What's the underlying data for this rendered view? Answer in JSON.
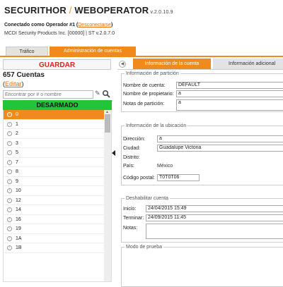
{
  "header": {
    "brand_left": "SECURITHOR",
    "brand_sep": " / ",
    "brand_right": "WEBOPERATOR",
    "version": " v.2.0.10.9",
    "connected_prefix": "Conectado como Operador #1 (",
    "disconnect_link": "Desconectarse",
    "connected_suffix": ")",
    "company": "MCDI Security Products Inc. [00000] | ST v.2.0.7.0"
  },
  "main_tabs": [
    {
      "label": "Tráfico"
    },
    {
      "label": "Administración de cuentas"
    }
  ],
  "left": {
    "save_label": "GUARDAR",
    "count_label": "657 Cuentas",
    "edit_open": "(",
    "edit_link": "Editar",
    "edit_close": ")",
    "search_placeholder": "Encontrar por # o nombre",
    "status_label": "DESARMADO",
    "accounts": [
      "0",
      "1",
      "2",
      "3",
      "5",
      "7",
      "8",
      "9",
      "10",
      "12",
      "14",
      "16",
      "19",
      "1A",
      "1B"
    ],
    "selected_index": 0
  },
  "right": {
    "subtabs": [
      {
        "label": "Información de la cuenta"
      },
      {
        "label": "Información adicional"
      }
    ],
    "partition": {
      "legend": "Información de partición",
      "account_name_label": "Nombre de cuenta:",
      "account_name_value": "DEFAULT",
      "owner_label": "Nombre de propietario:",
      "owner_value": "a",
      "notes_label": "Notas de partición:",
      "notes_value": "a"
    },
    "location": {
      "legend": "Información de la ubicación",
      "address_label": "Dirección:",
      "address_value": "a",
      "city_label": "Ciudad:",
      "city_value": "Guadalupe Victoria",
      "district_label": "Distrito:",
      "district_value": "",
      "country_label": "País:",
      "country_value": "México",
      "postal_label": "Código postal:",
      "postal_value": "T0T0T06"
    },
    "disable": {
      "legend": "Deshabilitar cuenta",
      "start_label": "Inicio:",
      "start_value": "24/04/2015 15:49",
      "end_label": "Terminar:",
      "end_value": "24/09/2015 11:45",
      "notes_label": "Notas:",
      "notes_value": ""
    },
    "test_mode": {
      "legend": "Modo de prueba"
    }
  },
  "colors": {
    "accent": "#f08a1c",
    "status_green": "#22c43a",
    "save_red": "#d12a1e"
  }
}
